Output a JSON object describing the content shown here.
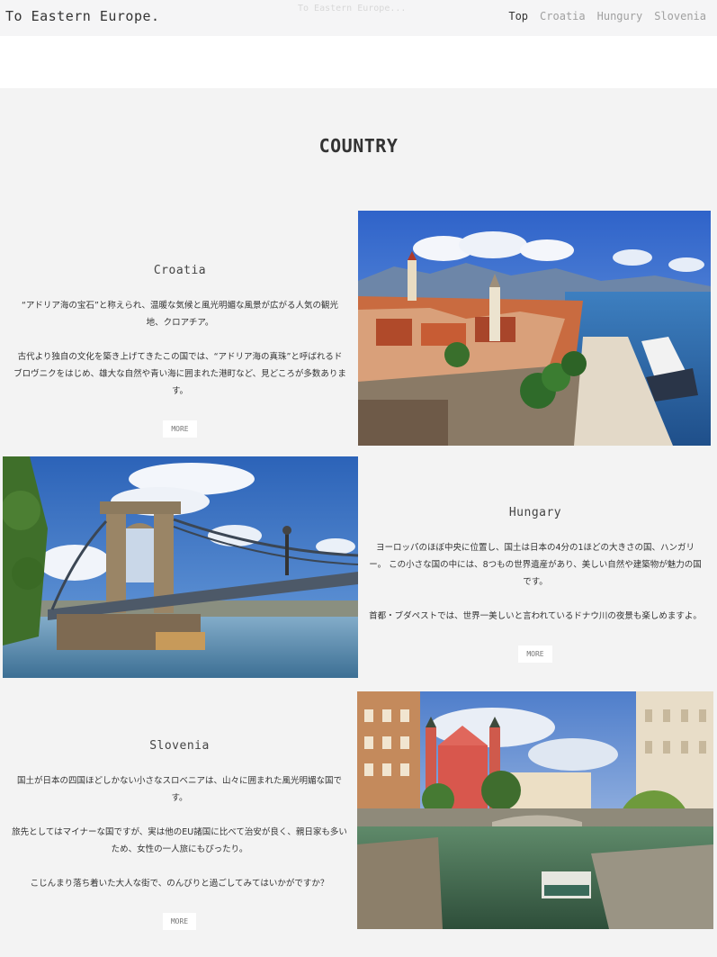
{
  "header": {
    "logo": "To Eastern Europe.",
    "ghost_title": "To Eastern Europe...",
    "nav": [
      "Top",
      "Croatia",
      "Hungury",
      "Slovenia"
    ]
  },
  "section": {
    "title": "COUNTRY"
  },
  "countries": [
    {
      "name": "Croatia",
      "paragraphs": [
        "“アドリア海の宝石”と称えられ、温暖な気候と風光明媚な風景が広がる人気の観光地、クロアチア。",
        "古代より独自の文化を築き上げてきたこの国では、“アドリア海の真珠”と呼ばれるドブロヴニクをはじめ、雄大な自然や青い海に囲まれた港町など、見どころが多数あります。"
      ],
      "more": "MORE"
    },
    {
      "name": "Hungary",
      "paragraphs": [
        "ヨーロッパのほぼ中央に位置し、国土は日本の4分の1ほどの大きさの国、ハンガリー。 この小さな国の中には、8つもの世界遺産があり、美しい自然や建築物が魅力の国です。",
        "首都・ブダペストでは、世界一美しいと言われているドナウ川の夜景も楽しめますよ。"
      ],
      "more": "MORE"
    },
    {
      "name": "Slovenia",
      "paragraphs": [
        "国土が日本の四国ほどしかない小さなスロベニアは、山々に囲まれた風光明媚な国です。",
        "旅先としてはマイナーな国ですが、実は他のEU諸国に比べて治安が良く、親日家も多いため、女性の一人旅にもぴったり。",
        "こじんまり落ち着いた大人な街で、のんびりと過ごしてみてはいかがですか？"
      ],
      "more": "MORE"
    }
  ]
}
